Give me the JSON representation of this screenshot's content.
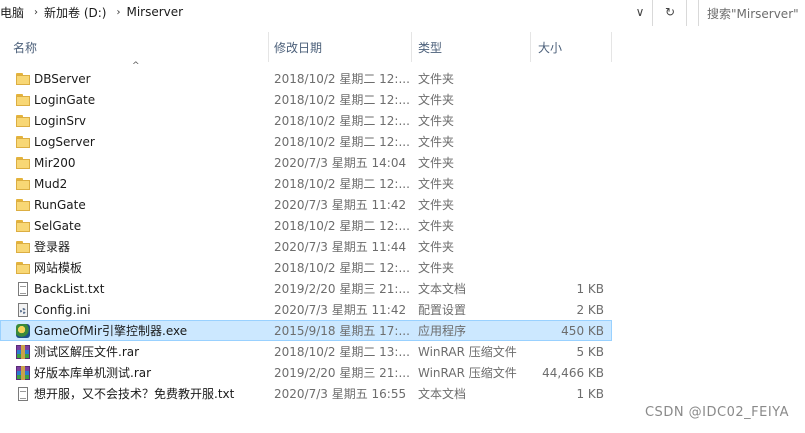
{
  "address_bar": {
    "crumbs": [
      "电脑",
      "新加卷 (D:)",
      "Mirserver"
    ],
    "dropdown_glyph": "∨",
    "refresh_glyph": "↻"
  },
  "search": {
    "placeholder": "搜索\"Mirserver\""
  },
  "columns": {
    "name": "名称",
    "date": "修改日期",
    "type": "类型",
    "size": "大小"
  },
  "files": [
    {
      "name": "DBServer",
      "date": "2018/10/2 星期二 12:...",
      "type": "文件夹",
      "size": "",
      "icon": "folder-icon"
    },
    {
      "name": "LoginGate",
      "date": "2018/10/2 星期二 12:...",
      "type": "文件夹",
      "size": "",
      "icon": "folder-icon"
    },
    {
      "name": "LoginSrv",
      "date": "2018/10/2 星期二 12:...",
      "type": "文件夹",
      "size": "",
      "icon": "folder-icon"
    },
    {
      "name": "LogServer",
      "date": "2018/10/2 星期二 12:...",
      "type": "文件夹",
      "size": "",
      "icon": "folder-icon"
    },
    {
      "name": "Mir200",
      "date": "2020/7/3 星期五 14:04",
      "type": "文件夹",
      "size": "",
      "icon": "folder-icon"
    },
    {
      "name": "Mud2",
      "date": "2018/10/2 星期二 12:...",
      "type": "文件夹",
      "size": "",
      "icon": "folder-icon"
    },
    {
      "name": "RunGate",
      "date": "2020/7/3 星期五 11:42",
      "type": "文件夹",
      "size": "",
      "icon": "folder-icon"
    },
    {
      "name": "SelGate",
      "date": "2018/10/2 星期二 12:...",
      "type": "文件夹",
      "size": "",
      "icon": "folder-icon"
    },
    {
      "name": "登录器",
      "date": "2020/7/3 星期五 11:44",
      "type": "文件夹",
      "size": "",
      "icon": "folder-icon"
    },
    {
      "name": "网站模板",
      "date": "2018/10/2 星期二 12:...",
      "type": "文件夹",
      "size": "",
      "icon": "folder-icon"
    },
    {
      "name": "BackList.txt",
      "date": "2019/2/20 星期三 21:...",
      "type": "文本文档",
      "size": "1 KB",
      "icon": "text-document-icon"
    },
    {
      "name": "Config.ini",
      "date": "2020/7/3 星期五 11:42",
      "type": "配置设置",
      "size": "2 KB",
      "icon": "config-file-icon"
    },
    {
      "name": "GameOfMir引擎控制器.exe",
      "date": "2015/9/18 星期五 17:...",
      "type": "应用程序",
      "size": "450 KB",
      "icon": "application-icon",
      "selected": true
    },
    {
      "name": "测试区解压文件.rar",
      "date": "2018/10/2 星期二 13:...",
      "type": "WinRAR 压缩文件",
      "size": "5 KB",
      "icon": "rar-archive-icon"
    },
    {
      "name": "好版本库单机测试.rar",
      "date": "2019/2/20 星期三 21:...",
      "type": "WinRAR 压缩文件",
      "size": "44,466 KB",
      "icon": "rar-archive-icon"
    },
    {
      "name": "想开服，又不会技术？免费教开服.txt",
      "date": "2020/7/3 星期五 16:55",
      "type": "文本文档",
      "size": "1 KB",
      "icon": "text-document-icon"
    }
  ],
  "watermark": "CSDN @IDC02_FEIYA",
  "colors": {
    "selected_bg": "#cce8ff",
    "selected_border": "#99d1ff",
    "header_text": "#4c607a",
    "folder": "#f8d775"
  }
}
